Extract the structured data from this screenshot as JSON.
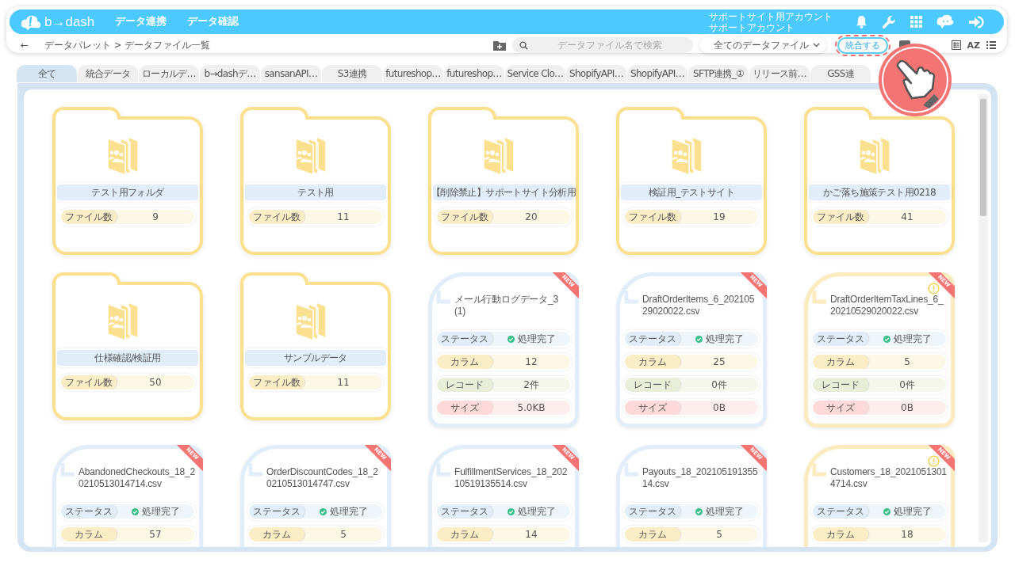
{
  "header": {
    "logo": "b→dash",
    "nav": [
      "データ連携",
      "データ確認"
    ],
    "account": [
      "サポートサイト用アカウント",
      "サポートアカウント"
    ]
  },
  "toolbar": {
    "back": "←",
    "breadcrumb": "データパレット > データファイル一覧",
    "search": {
      "placeholder": "データファイル名で検索"
    },
    "filter": "全てのデータファイル",
    "merge_button": "統合する",
    "sort_label": "AZ"
  },
  "tabs": [
    {
      "label": "全て",
      "selected": true
    },
    {
      "label": "統合データ",
      "selected": false
    },
    {
      "label": "ローカルデ…",
      "selected": false
    },
    {
      "label": "b→dashデ…",
      "selected": false
    },
    {
      "label": "sansanAPI…",
      "selected": false
    },
    {
      "label": "S3連携",
      "selected": false
    },
    {
      "label": "futureshop…",
      "selected": false
    },
    {
      "label": "futureshop…",
      "selected": false
    },
    {
      "label": "Service Clo…",
      "selected": false
    },
    {
      "label": "ShopifyAPI…",
      "selected": false
    },
    {
      "label": "ShopifyAPI…",
      "selected": false
    },
    {
      "label": "SFTP連携_①",
      "selected": false
    },
    {
      "label": "リリース前…",
      "selected": false
    },
    {
      "label": "GSS連",
      "selected": false
    }
  ],
  "cards": [
    {
      "kind": "folder",
      "name": "テスト用フォルダ",
      "count_label": "ファイル数",
      "count": "9"
    },
    {
      "kind": "folder",
      "name": "テスト用",
      "count_label": "ファイル数",
      "count": "11"
    },
    {
      "kind": "folder",
      "name": "【削除禁止】サポートサイト分析用",
      "count_label": "ファイル数",
      "count": "20"
    },
    {
      "kind": "folder",
      "name": "検証用_テストサイト",
      "count_label": "ファイル数",
      "count": "19"
    },
    {
      "kind": "folder",
      "name": "かご落ち施策テスト用0218",
      "count_label": "ファイル数",
      "count": "41"
    },
    {
      "kind": "folder",
      "name": "仕様確認/検証用",
      "count_label": "ファイル数",
      "count": "50"
    },
    {
      "kind": "folder",
      "name": "サンプルデータ",
      "count_label": "ファイル数",
      "count": "11"
    },
    {
      "kind": "file",
      "name": "メール行動ログデータ_3 (1)",
      "badge": "NEW",
      "warning": false,
      "stats": [
        {
          "kind": "status",
          "label": "ステータス",
          "value": "処理完了"
        },
        {
          "kind": "columns",
          "label": "カラム",
          "value": "12"
        },
        {
          "kind": "records",
          "label": "レコード",
          "value": "2件"
        },
        {
          "kind": "size",
          "label": "サイズ",
          "value": "5.0KB"
        }
      ]
    },
    {
      "kind": "file",
      "name": "DraftOrderItems_6_20210529020022.csv",
      "badge": "NEW",
      "warning": false,
      "stats": [
        {
          "kind": "status",
          "label": "ステータス",
          "value": "処理完了"
        },
        {
          "kind": "columns",
          "label": "カラム",
          "value": "25"
        },
        {
          "kind": "records",
          "label": "レコード",
          "value": "0件"
        },
        {
          "kind": "size",
          "label": "サイズ",
          "value": "0B"
        }
      ]
    },
    {
      "kind": "file",
      "name": "DraftOrderItemTaxLines_6_20210529020022.csv",
      "badge": "NEW",
      "warning": true,
      "stats": [
        {
          "kind": "status",
          "label": "ステータス",
          "value": "処理完了"
        },
        {
          "kind": "columns",
          "label": "カラム",
          "value": "5"
        },
        {
          "kind": "records",
          "label": "レコード",
          "value": "0件"
        },
        {
          "kind": "size",
          "label": "サイズ",
          "value": "0B"
        }
      ]
    },
    {
      "kind": "file",
      "name": "AbandonedCheckouts_18_20210513014714.csv",
      "badge": "NEW",
      "warning": false,
      "stats": [
        {
          "kind": "status",
          "label": "ステータス",
          "value": "処理完了"
        },
        {
          "kind": "columns",
          "label": "カラム",
          "value": "57"
        }
      ]
    },
    {
      "kind": "file",
      "name": "OrderDiscountCodes_18_20210513014747.csv",
      "badge": "NEW",
      "warning": false,
      "stats": [
        {
          "kind": "status",
          "label": "ステータス",
          "value": "処理完了"
        },
        {
          "kind": "columns",
          "label": "カラム",
          "value": "5"
        }
      ]
    },
    {
      "kind": "file",
      "name": "FulfillmentServices_18_20210519135514.csv",
      "badge": "NEW",
      "warning": false,
      "stats": [
        {
          "kind": "status",
          "label": "ステータス",
          "value": "処理完了"
        },
        {
          "kind": "columns",
          "label": "カラム",
          "value": "14"
        }
      ]
    },
    {
      "kind": "file",
      "name": "Payouts_18_20210519135514.csv",
      "badge": "NEW",
      "warning": false,
      "stats": [
        {
          "kind": "status",
          "label": "ステータス",
          "value": "処理完了"
        },
        {
          "kind": "columns",
          "label": "カラム",
          "value": "5"
        }
      ]
    },
    {
      "kind": "file",
      "name": "Customers_18_20210513014714.csv",
      "badge": "NEW",
      "warning": true,
      "stats": [
        {
          "kind": "status",
          "label": "ステータス",
          "value": "処理完了"
        },
        {
          "kind": "columns",
          "label": "カラム",
          "value": "18"
        }
      ]
    }
  ]
}
